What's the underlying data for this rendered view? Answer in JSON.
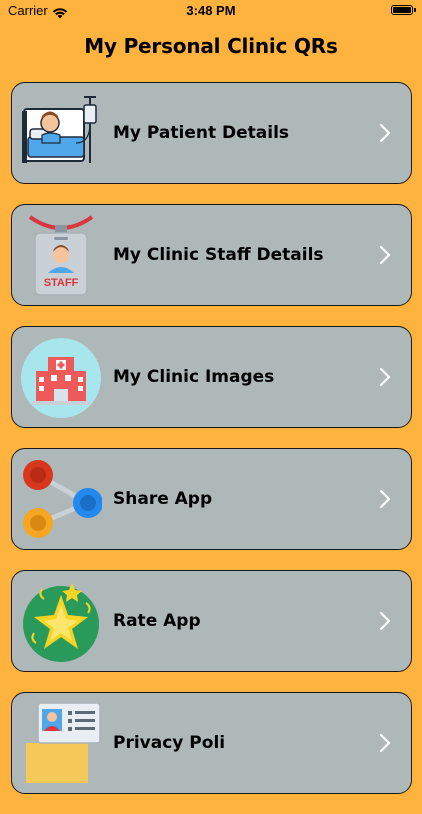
{
  "status_bar": {
    "carrier": "Carrier",
    "time": "3:48 PM"
  },
  "header": {
    "title": "My Personal Clinic QRs"
  },
  "menu": {
    "items": [
      {
        "label": "My Patient Details",
        "icon": "patient-bed-icon"
      },
      {
        "label": "My Clinic Staff Details",
        "icon": "staff-badge-icon"
      },
      {
        "label": "My Clinic Images",
        "icon": "hospital-building-icon"
      },
      {
        "label": "Share App",
        "icon": "share-nodes-icon"
      },
      {
        "label": "Rate App",
        "icon": "star-badge-icon"
      },
      {
        "label": "Privacy Poli",
        "icon": "profile-card-icon"
      }
    ]
  },
  "colors": {
    "background": "#FEB33E",
    "card": "#AEB8B8",
    "chevron": "#FFFFFF"
  }
}
